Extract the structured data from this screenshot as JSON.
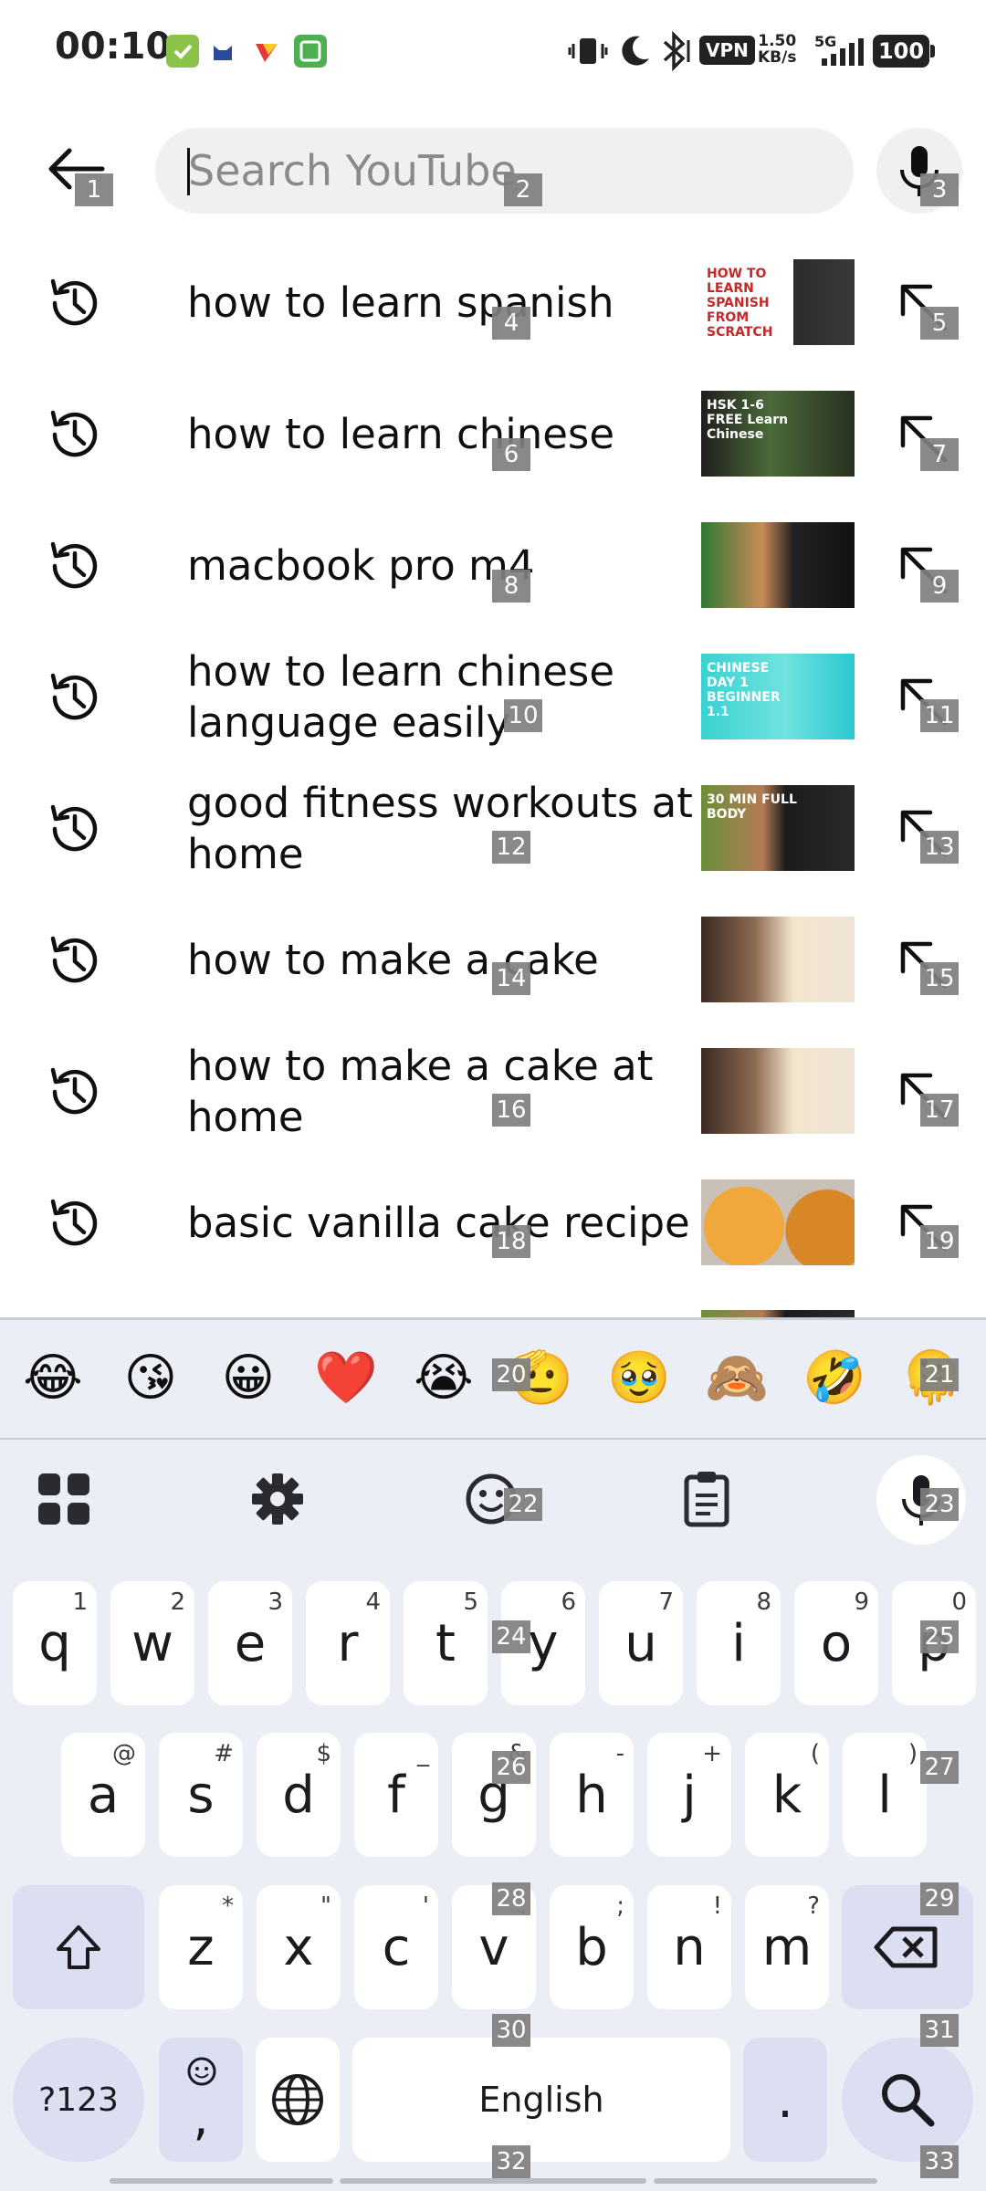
{
  "status_bar": {
    "time": "00:10",
    "vpn": "VPN",
    "speed_value": "1.50",
    "speed_unit": "KB/s",
    "network": "5G",
    "battery": "100"
  },
  "search": {
    "placeholder": "Search YouTube",
    "value": ""
  },
  "suggestions": [
    {
      "text": "how to learn spanish",
      "thumb_caption": "HOW TO LEARN SPANISH FROM SCRATCH"
    },
    {
      "text": "how to learn chinese",
      "thumb_caption": "HSK 1-6 FREE Learn Chinese"
    },
    {
      "text": "macbook pro m4",
      "thumb_caption": ""
    },
    {
      "text": "how to learn chinese language easily",
      "thumb_caption": "CHINESE DAY 1 BEGINNER 1.1"
    },
    {
      "text": "good fitness workouts at home",
      "thumb_caption": "30 MIN FULL BODY"
    },
    {
      "text": "how to make a cake",
      "thumb_caption": ""
    },
    {
      "text": "how to make a cake at home",
      "thumb_caption": ""
    },
    {
      "text": "basic vanilla cake recipe",
      "thumb_caption": ""
    }
  ],
  "emojis": [
    "😂",
    "😘",
    "😀",
    "❤️",
    "😭",
    "🫡",
    "🥹",
    "🙈",
    "🤣",
    "🫠"
  ],
  "keyboard": {
    "row1": [
      {
        "k": "q",
        "s": "1"
      },
      {
        "k": "w",
        "s": "2"
      },
      {
        "k": "e",
        "s": "3"
      },
      {
        "k": "r",
        "s": "4"
      },
      {
        "k": "t",
        "s": "5"
      },
      {
        "k": "y",
        "s": "6"
      },
      {
        "k": "u",
        "s": "7"
      },
      {
        "k": "i",
        "s": "8"
      },
      {
        "k": "o",
        "s": "9"
      },
      {
        "k": "p",
        "s": "0"
      }
    ],
    "row2": [
      {
        "k": "a",
        "s": "@"
      },
      {
        "k": "s",
        "s": "#"
      },
      {
        "k": "d",
        "s": "$"
      },
      {
        "k": "f",
        "s": "_"
      },
      {
        "k": "g",
        "s": "&"
      },
      {
        "k": "h",
        "s": "-"
      },
      {
        "k": "j",
        "s": "+"
      },
      {
        "k": "k",
        "s": "("
      },
      {
        "k": "l",
        "s": ")"
      }
    ],
    "row3": [
      {
        "k": "z",
        "s": "*"
      },
      {
        "k": "x",
        "s": "\""
      },
      {
        "k": "c",
        "s": "'"
      },
      {
        "k": "v",
        "s": ":"
      },
      {
        "k": "b",
        "s": ";"
      },
      {
        "k": "n",
        "s": "!"
      },
      {
        "k": "m",
        "s": "?"
      }
    ],
    "symbols_label": "?123",
    "comma": ",",
    "space_label": "English",
    "period": "."
  },
  "markers": [
    "1",
    "2",
    "3",
    "4",
    "5",
    "6",
    "7",
    "8",
    "9",
    "10",
    "11",
    "12",
    "13",
    "14",
    "15",
    "16",
    "17",
    "18",
    "19",
    "20",
    "21",
    "22",
    "23",
    "24",
    "25",
    "26",
    "27",
    "28",
    "29",
    "30",
    "31",
    "32",
    "33"
  ],
  "colors": {
    "keyboard_bg": "#eceef5",
    "special_key": "#dcdff2",
    "search_bg": "#f0f0f0"
  }
}
